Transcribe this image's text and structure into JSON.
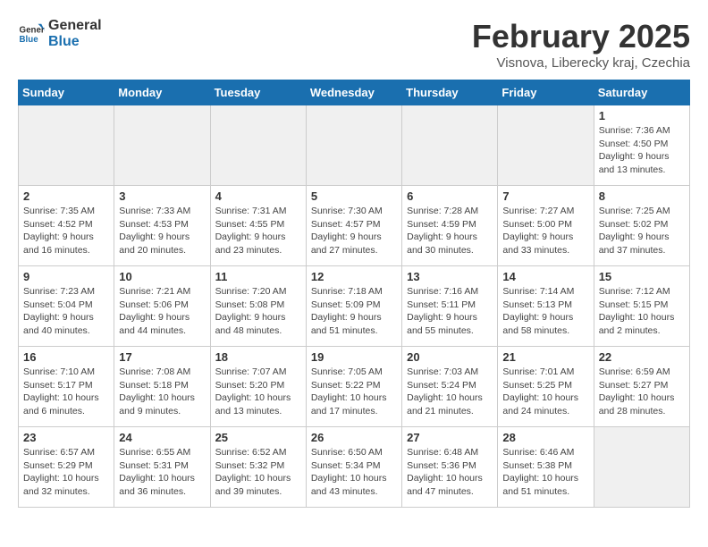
{
  "header": {
    "logo_general": "General",
    "logo_blue": "Blue",
    "title": "February 2025",
    "subtitle": "Visnova, Liberecky kraj, Czechia"
  },
  "weekdays": [
    "Sunday",
    "Monday",
    "Tuesday",
    "Wednesday",
    "Thursday",
    "Friday",
    "Saturday"
  ],
  "weeks": [
    [
      {
        "day": "",
        "info": "",
        "shaded": true
      },
      {
        "day": "",
        "info": "",
        "shaded": true
      },
      {
        "day": "",
        "info": "",
        "shaded": true
      },
      {
        "day": "",
        "info": "",
        "shaded": true
      },
      {
        "day": "",
        "info": "",
        "shaded": true
      },
      {
        "day": "",
        "info": "",
        "shaded": true
      },
      {
        "day": "1",
        "info": "Sunrise: 7:36 AM\nSunset: 4:50 PM\nDaylight: 9 hours and 13 minutes.",
        "shaded": false
      }
    ],
    [
      {
        "day": "2",
        "info": "Sunrise: 7:35 AM\nSunset: 4:52 PM\nDaylight: 9 hours and 16 minutes.",
        "shaded": false
      },
      {
        "day": "3",
        "info": "Sunrise: 7:33 AM\nSunset: 4:53 PM\nDaylight: 9 hours and 20 minutes.",
        "shaded": false
      },
      {
        "day": "4",
        "info": "Sunrise: 7:31 AM\nSunset: 4:55 PM\nDaylight: 9 hours and 23 minutes.",
        "shaded": false
      },
      {
        "day": "5",
        "info": "Sunrise: 7:30 AM\nSunset: 4:57 PM\nDaylight: 9 hours and 27 minutes.",
        "shaded": false
      },
      {
        "day": "6",
        "info": "Sunrise: 7:28 AM\nSunset: 4:59 PM\nDaylight: 9 hours and 30 minutes.",
        "shaded": false
      },
      {
        "day": "7",
        "info": "Sunrise: 7:27 AM\nSunset: 5:00 PM\nDaylight: 9 hours and 33 minutes.",
        "shaded": false
      },
      {
        "day": "8",
        "info": "Sunrise: 7:25 AM\nSunset: 5:02 PM\nDaylight: 9 hours and 37 minutes.",
        "shaded": false
      }
    ],
    [
      {
        "day": "9",
        "info": "Sunrise: 7:23 AM\nSunset: 5:04 PM\nDaylight: 9 hours and 40 minutes.",
        "shaded": false
      },
      {
        "day": "10",
        "info": "Sunrise: 7:21 AM\nSunset: 5:06 PM\nDaylight: 9 hours and 44 minutes.",
        "shaded": false
      },
      {
        "day": "11",
        "info": "Sunrise: 7:20 AM\nSunset: 5:08 PM\nDaylight: 9 hours and 48 minutes.",
        "shaded": false
      },
      {
        "day": "12",
        "info": "Sunrise: 7:18 AM\nSunset: 5:09 PM\nDaylight: 9 hours and 51 minutes.",
        "shaded": false
      },
      {
        "day": "13",
        "info": "Sunrise: 7:16 AM\nSunset: 5:11 PM\nDaylight: 9 hours and 55 minutes.",
        "shaded": false
      },
      {
        "day": "14",
        "info": "Sunrise: 7:14 AM\nSunset: 5:13 PM\nDaylight: 9 hours and 58 minutes.",
        "shaded": false
      },
      {
        "day": "15",
        "info": "Sunrise: 7:12 AM\nSunset: 5:15 PM\nDaylight: 10 hours and 2 minutes.",
        "shaded": false
      }
    ],
    [
      {
        "day": "16",
        "info": "Sunrise: 7:10 AM\nSunset: 5:17 PM\nDaylight: 10 hours and 6 minutes.",
        "shaded": false
      },
      {
        "day": "17",
        "info": "Sunrise: 7:08 AM\nSunset: 5:18 PM\nDaylight: 10 hours and 9 minutes.",
        "shaded": false
      },
      {
        "day": "18",
        "info": "Sunrise: 7:07 AM\nSunset: 5:20 PM\nDaylight: 10 hours and 13 minutes.",
        "shaded": false
      },
      {
        "day": "19",
        "info": "Sunrise: 7:05 AM\nSunset: 5:22 PM\nDaylight: 10 hours and 17 minutes.",
        "shaded": false
      },
      {
        "day": "20",
        "info": "Sunrise: 7:03 AM\nSunset: 5:24 PM\nDaylight: 10 hours and 21 minutes.",
        "shaded": false
      },
      {
        "day": "21",
        "info": "Sunrise: 7:01 AM\nSunset: 5:25 PM\nDaylight: 10 hours and 24 minutes.",
        "shaded": false
      },
      {
        "day": "22",
        "info": "Sunrise: 6:59 AM\nSunset: 5:27 PM\nDaylight: 10 hours and 28 minutes.",
        "shaded": false
      }
    ],
    [
      {
        "day": "23",
        "info": "Sunrise: 6:57 AM\nSunset: 5:29 PM\nDaylight: 10 hours and 32 minutes.",
        "shaded": false
      },
      {
        "day": "24",
        "info": "Sunrise: 6:55 AM\nSunset: 5:31 PM\nDaylight: 10 hours and 36 minutes.",
        "shaded": false
      },
      {
        "day": "25",
        "info": "Sunrise: 6:52 AM\nSunset: 5:32 PM\nDaylight: 10 hours and 39 minutes.",
        "shaded": false
      },
      {
        "day": "26",
        "info": "Sunrise: 6:50 AM\nSunset: 5:34 PM\nDaylight: 10 hours and 43 minutes.",
        "shaded": false
      },
      {
        "day": "27",
        "info": "Sunrise: 6:48 AM\nSunset: 5:36 PM\nDaylight: 10 hours and 47 minutes.",
        "shaded": false
      },
      {
        "day": "28",
        "info": "Sunrise: 6:46 AM\nSunset: 5:38 PM\nDaylight: 10 hours and 51 minutes.",
        "shaded": false
      },
      {
        "day": "",
        "info": "",
        "shaded": true
      }
    ]
  ]
}
